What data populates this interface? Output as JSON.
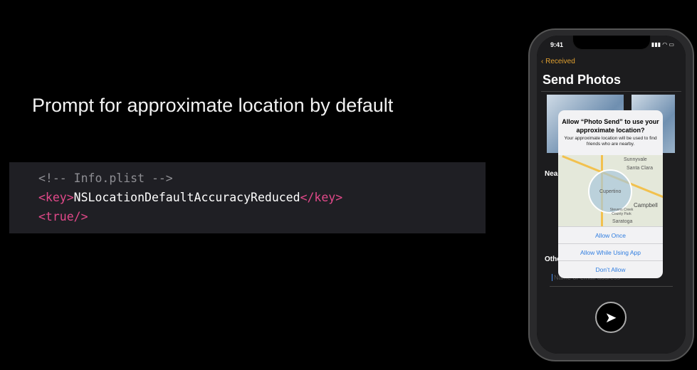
{
  "slide": {
    "title": "Prompt for approximate location by default"
  },
  "code": {
    "comment": "<!-- Info.plist -->",
    "key_open": "<key>",
    "key_value": "NSLocationDefaultAccuracyReduced",
    "key_close": "</key>",
    "true_tag": "<true/>"
  },
  "phone": {
    "status_time": "9:41",
    "back_label": "Received",
    "nav_title": "Send Photos",
    "section_nearby": "Nea",
    "section_other": "Othe",
    "recipient_placeholder": "Name or email address",
    "alert": {
      "title": "Allow “Photo Send” to use your approximate location?",
      "message": "Your approximate location will be used to find friends who are nearby.",
      "map_labels": [
        "Sunnyvale",
        "Santa Clara",
        "Cupertino",
        "Campbell",
        "Stevens Creek County Park",
        "Saratoga"
      ],
      "buttons": [
        "Allow Once",
        "Allow While Using App",
        "Don’t Allow"
      ]
    }
  }
}
